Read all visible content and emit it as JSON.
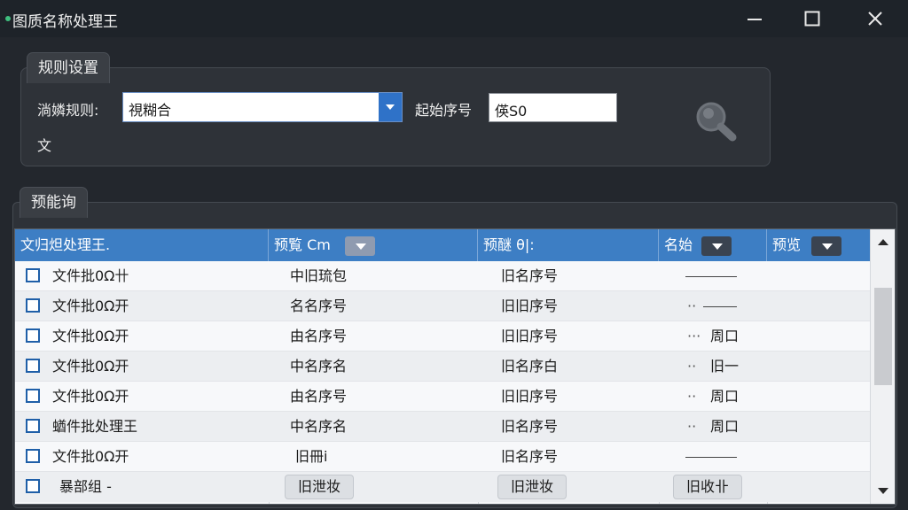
{
  "window": {
    "title": "图质名称处理王"
  },
  "rules_panel": {
    "tab_label": "规则设置",
    "filter_label": "淌嫾规则:",
    "filter_value": "視糊合",
    "start_label": "起始序号",
    "start_value": "偀S0",
    "extra_label": "文"
  },
  "preview_panel": {
    "tab_label": "预能询"
  },
  "grid": {
    "headers": [
      "文归炟处理王.",
      "预覧  Cm",
      "预醚  θ|:",
      "名始",
      "预览"
    ],
    "rows": [
      {
        "name": "文件批0Ω卄",
        "c2": "中旧琉包",
        "c3": "旧名序号",
        "c4a": "",
        "c4b": ""
      },
      {
        "name": "文件批0Ω开",
        "c2": "名名序号",
        "c3": "旧旧序号",
        "c4a": "··",
        "c4b": ""
      },
      {
        "name": "文件批0Ω开",
        "c2": "由名序号",
        "c3": "旧旧序号",
        "c4a": "···",
        "c4b": "周口"
      },
      {
        "name": "文件批0Ω开",
        "c2": "中名序名",
        "c3": "旧名序白",
        "c4a": "··",
        "c4b": "旧一"
      },
      {
        "name": "文件批0Ω开",
        "c2": "由名序号",
        "c3": "旧旧序号",
        "c4a": "··",
        "c4b": "周口"
      },
      {
        "name": "蝤件批处理王",
        "c2": "中名序名",
        "c3": "旧名序号",
        "c4a": "··",
        "c4b": "周口"
      },
      {
        "name": "文件批0Ω开",
        "c2": "旧冊i",
        "c3": "旧名序号",
        "c4a": "",
        "c4b": ""
      },
      {
        "name": "暴部组 -",
        "c2": "旧泄妆",
        "c3": "旧泄妆",
        "c4a": "",
        "c4b": "旧收卝"
      }
    ]
  },
  "colors": {
    "accent": "#3d7ec4",
    "window_bg": "#23272d"
  }
}
